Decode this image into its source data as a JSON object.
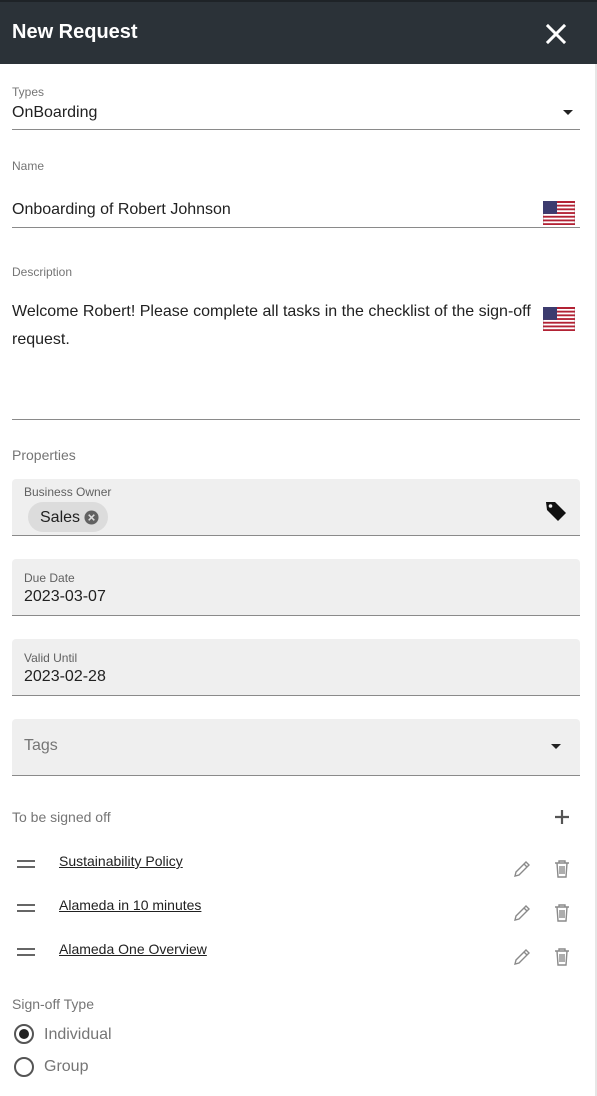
{
  "header": {
    "title": "New Request"
  },
  "types": {
    "label": "Types",
    "value": "OnBoarding"
  },
  "name": {
    "label": "Name",
    "value": "Onboarding of Robert Johnson"
  },
  "description": {
    "label": "Description",
    "value": "Welcome Robert! Please complete all tasks in the checklist of the sign-off request."
  },
  "properties": {
    "section_label": "Properties",
    "business_owner": {
      "label": "Business Owner",
      "chips": [
        "Sales"
      ]
    },
    "due_date": {
      "label": "Due Date",
      "value": "2023-03-07"
    },
    "valid_until": {
      "label": "Valid Until",
      "value": "2023-02-28"
    },
    "tags": {
      "placeholder": "Tags"
    }
  },
  "signoff": {
    "section_label": "To be signed off",
    "items": [
      {
        "title": "Sustainability Policy"
      },
      {
        "title": "Alameda in 10 minutes"
      },
      {
        "title": "Alameda One Overview"
      }
    ]
  },
  "signoff_type": {
    "label": "Sign-off Type",
    "options": [
      {
        "label": "Individual",
        "selected": true
      },
      {
        "label": "Group",
        "selected": false
      }
    ]
  },
  "colors": {
    "header_bg": "#2b3238",
    "field_bg": "#efefef",
    "chip_bg": "#dcdcdc"
  }
}
